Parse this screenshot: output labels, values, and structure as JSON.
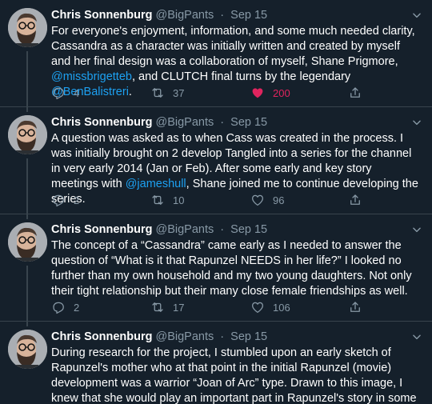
{
  "tweets": [
    {
      "name": "Chris Sonnenburg",
      "handle": "@BigPants",
      "sep": "·",
      "date": "Sep 15",
      "text": [
        {
          "t": "For everyone's enjoyment, information, and some much needed clarity, Cassandra as a character was initially written and created by myself and her final design was a collaboration of myself, Shane Prigmore, "
        },
        {
          "t": "@missbrigetteb",
          "link": true
        },
        {
          "t": ", and CLUTCH final turns by the legendary "
        },
        {
          "t": "@BenBalistreri",
          "link": true
        },
        {
          "t": "."
        }
      ],
      "reply_count": "4",
      "retweet_count": "37",
      "like_count": "200",
      "liked": true
    },
    {
      "name": "Chris Sonnenburg",
      "handle": "@BigPants",
      "sep": "·",
      "date": "Sep 15",
      "text": [
        {
          "t": "A question was asked as to when Cass was created in the process. I was initially brought on 2 develop Tangled into a series for the channel in very early 2014 (Jan or Feb). After some early and key story meetings with "
        },
        {
          "t": "@jameshull",
          "link": true
        },
        {
          "t": ", Shane joined me to continue developing the series."
        }
      ],
      "reply_count": "2",
      "retweet_count": "10",
      "like_count": "96",
      "liked": false
    },
    {
      "name": "Chris Sonnenburg",
      "handle": "@BigPants",
      "sep": "·",
      "date": "Sep 15",
      "text": [
        {
          "t": "The concept of a “Cassandra” came early as I needed to answer the question of “What is it that Rapunzel NEEDS in her life?” I looked no further than my own household and my two young daughters. Not only their tight relationship but their many close female friendships as well."
        }
      ],
      "reply_count": "2",
      "retweet_count": "17",
      "like_count": "106",
      "liked": false
    },
    {
      "name": "Chris Sonnenburg",
      "handle": "@BigPants",
      "sep": "·",
      "date": "Sep 15",
      "text": [
        {
          "t": "During research for the project, I stumbled upon an early sketch of Rapunzel's mother who at that point in the initial Rapunzel (movie) development was a warrior “Joan of Arc” type. Drawn to this image, I knew that she would play an important part in Rapunzel's story in some way."
        }
      ],
      "reply_count": "",
      "retweet_count": "",
      "like_count": "",
      "liked": false
    }
  ],
  "colors": {
    "background": "#15202b",
    "secondary_text": "#8899a6",
    "link": "#1da1f2",
    "like_active": "#e0245e",
    "divider": "#38444d"
  },
  "icons": [
    "reply-icon",
    "retweet-icon",
    "like-icon",
    "share-icon",
    "chevron-down-icon"
  ]
}
